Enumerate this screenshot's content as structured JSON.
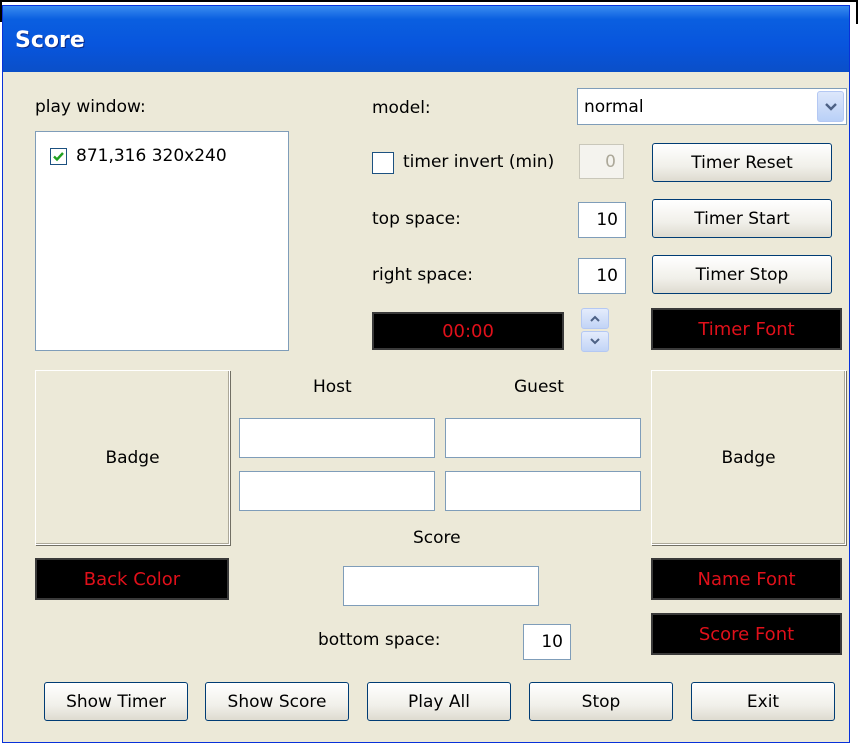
{
  "window": {
    "title": "Score"
  },
  "play_window": {
    "label": "play window:",
    "items": [
      {
        "label": "871,316 320x240",
        "checked": true
      }
    ]
  },
  "model": {
    "label": "model:",
    "selected": "normal"
  },
  "timer_invert": {
    "label": "timer invert (min)",
    "checked": false,
    "value": "0"
  },
  "top_space": {
    "label": "top space:",
    "value": "10"
  },
  "right_space": {
    "label": "right space:",
    "value": "10"
  },
  "timer_display": {
    "value": "00:00"
  },
  "buttons": {
    "timer_reset": "Timer Reset",
    "timer_start": "Timer Start",
    "timer_stop": "Timer Stop",
    "timer_font": "Timer Font",
    "name_font": "Name Font",
    "score_font": "Score Font",
    "back_color": "Back Color",
    "show_timer": "Show Timer",
    "show_score": "Show Score",
    "play_all": "Play All",
    "stop": "Stop",
    "exit": "Exit"
  },
  "badges": {
    "left": "Badge",
    "right": "Badge"
  },
  "teams": {
    "host_label": "Host",
    "guest_label": "Guest",
    "host_fields": [
      "",
      ""
    ],
    "guest_fields": [
      "",
      ""
    ]
  },
  "score": {
    "label": "Score",
    "value": ""
  },
  "bottom_space": {
    "label": "bottom space:",
    "value": "10"
  },
  "colors": {
    "title_bar": "#0855dd",
    "font_red": "#e0101a",
    "dialog_bg": "#ece9d8",
    "check_green": "#21a121"
  },
  "icons": [
    "checkbox-checked-icon",
    "chevron-down-icon",
    "spin-up-icon",
    "spin-down-icon"
  ]
}
